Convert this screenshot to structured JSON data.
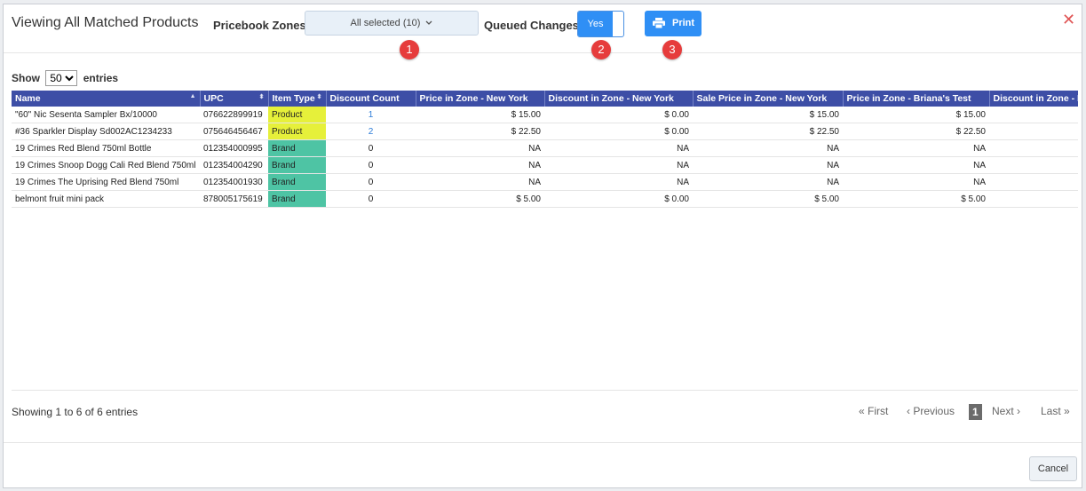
{
  "header": {
    "title": "Viewing All Matched Products",
    "zones_label": "Pricebook Zones:",
    "zones_value": "All selected (10)",
    "queued_label": "Queued Changes:",
    "queued_toggle": "Yes",
    "print_label": "Print",
    "close": "✕"
  },
  "badges": [
    "1",
    "2",
    "3"
  ],
  "length": {
    "show": "Show",
    "value": "50",
    "entries": "entries"
  },
  "table": {
    "headers": [
      "Name",
      "UPC",
      "Item Type",
      "Discount Count",
      "Price in Zone - New York",
      "Discount in Zone - New York",
      "Sale Price in Zone - New York",
      "Price in Zone - Briana's Test",
      "Discount in Zone - Briana's Test"
    ],
    "rows": [
      [
        "\"60\" Nic Sesenta Sampler Bx/10000",
        "076622899919",
        "Product",
        "1",
        "$ 15.00",
        "$ 0.00",
        "$ 15.00",
        "$ 15.00",
        ""
      ],
      [
        "#36 Sparkler Display Sd002AC1234233",
        "075646456467",
        "Product",
        "2",
        "$ 22.50",
        "$ 0.00",
        "$ 22.50",
        "$ 22.50",
        ""
      ],
      [
        "19 Crimes Red Blend 750ml Bottle",
        "012354000995",
        "Brand",
        "0",
        "NA",
        "NA",
        "NA",
        "NA",
        ""
      ],
      [
        "19 Crimes Snoop Dogg Cali Red Blend 750ml",
        "012354004290",
        "Brand",
        "0",
        "NA",
        "NA",
        "NA",
        "NA",
        ""
      ],
      [
        "19 Crimes The Uprising Red Blend 750ml",
        "012354001930",
        "Brand",
        "0",
        "NA",
        "NA",
        "NA",
        "NA",
        ""
      ],
      [
        "belmont fruit mini pack",
        "878005175619",
        "Brand",
        "0",
        "$ 5.00",
        "$ 0.00",
        "$ 5.00",
        "$ 5.00",
        ""
      ]
    ]
  },
  "footer": {
    "info": "Showing 1 to 6 of 6 entries",
    "first": "« First",
    "previous": "‹ Previous",
    "page": "1",
    "next": "Next ›",
    "last": "Last »"
  },
  "cancel_label": "Cancel",
  "colors": {
    "header_bg": "#3d4ea6",
    "primary": "#2f8ff5",
    "badge": "#e63c3c",
    "product": "#e6f03a",
    "brand": "#4ec4a4"
  }
}
